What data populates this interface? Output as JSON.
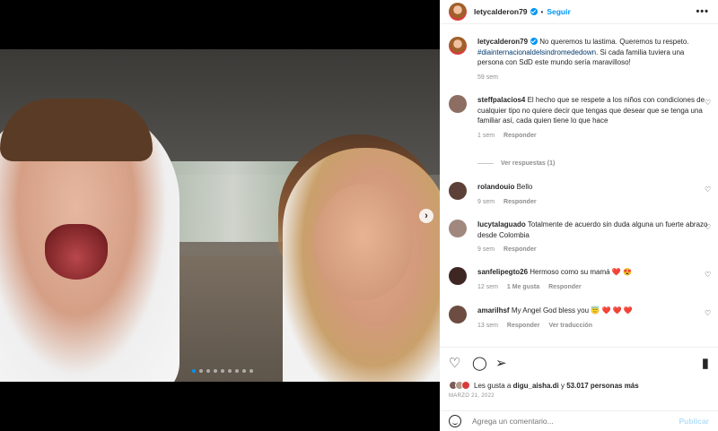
{
  "post": {
    "author": "letycalderon79",
    "follow_label": "Seguir",
    "separator": "•",
    "more_label": "•••"
  },
  "caption": {
    "author": "letycalderon79",
    "text_1": "No queremos tu lastima. Queremos tu respeto.",
    "hashtag": "#diainternacionaldelsindromededown",
    "text_2": ". Si cada familia tuviera una persona con SdD este mundo sería maravilloso!",
    "time": "59 sem"
  },
  "comments": [
    {
      "user": "steffpalacios4",
      "text": "El hecho que se respete a los niños con condiciones de cualquier tipo no quiere decir que tengas que desear que se tenga una familiar así, cada quien tiene lo que hace",
      "time": "1 sem",
      "reply": "Responder",
      "avatar_color": "#8d6e63"
    },
    {
      "user": "rolandouio",
      "text": "Bello",
      "time": "9 sem",
      "reply": "Responder",
      "avatar_color": "#5d4037"
    },
    {
      "user": "lucytalaguado",
      "text": "Totalmente de acuerdo sin duda alguna un fuerte abrazo desde Colombia",
      "time": "9 sem",
      "reply": "Responder",
      "avatar_color": "#a1887f"
    },
    {
      "user": "sanfelipegto26",
      "text": "Hermoso como su mamá ❤️ 😍",
      "time": "12 sem",
      "likes": "1 Me gusta",
      "reply": "Responder",
      "avatar_color": "#3e2723"
    },
    {
      "user": "amarilhsf",
      "text": "My Angel God bless you 😇 ❤️ ❤️ ❤️",
      "time": "13 sem",
      "reply": "Responder",
      "translate": "Ver traducción",
      "avatar_color": "#6d4c41"
    }
  ],
  "view_replies": "Ver respuestas (1)",
  "likes": {
    "prefix": "Les gusta a",
    "user": "digu_aisha.di",
    "conj": "y",
    "count": "53.017 personas más"
  },
  "date": "MARZO 21, 2022",
  "add_comment": {
    "placeholder": "Agrega un comentario...",
    "publish": "Publicar"
  },
  "icons": {
    "like": "heart-icon",
    "comment": "comment-icon",
    "share": "paper-plane-icon",
    "save": "bookmark-icon",
    "emoji": "emoji-icon"
  },
  "carousel": {
    "slides": 9,
    "active": 1
  },
  "colors": {
    "accent": "#0095f6",
    "muted": "#8e8e8e",
    "text": "#262626"
  }
}
